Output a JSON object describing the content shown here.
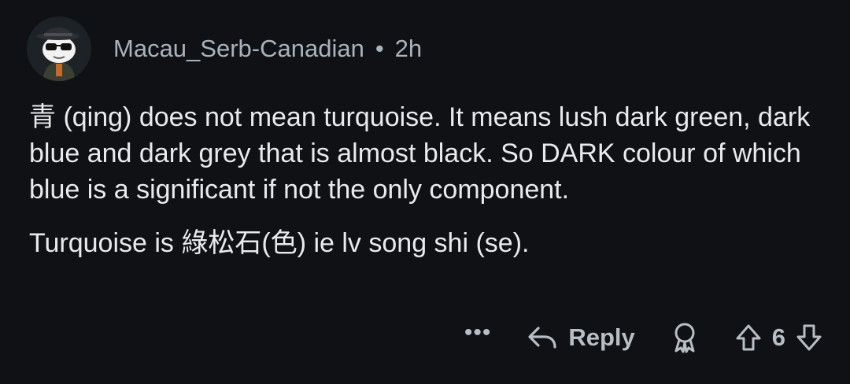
{
  "comment": {
    "author": "Macau_Serb-Canadian",
    "separator": "•",
    "time": "2h",
    "paragraphs": [
      "青 (qing) does not mean turquoise. It means lush dark green, dark blue and dark grey that is almost black. So DARK colour of which blue is a significant if not the only component.",
      "Turquoise is 綠松石(色) ie lv song shi (se)."
    ]
  },
  "actions": {
    "more": "•••",
    "reply_label": "Reply",
    "vote_count": "6"
  },
  "icons": {
    "avatar": "snoo-avatar-icon",
    "more": "more-options-icon",
    "reply": "reply-arrow-icon",
    "award": "award-icon",
    "upvote": "upvote-arrow-icon",
    "downvote": "downvote-arrow-icon"
  },
  "colors": {
    "background": "#0f1114",
    "text": "#e8eaec",
    "meta": "#a9b3bb"
  }
}
